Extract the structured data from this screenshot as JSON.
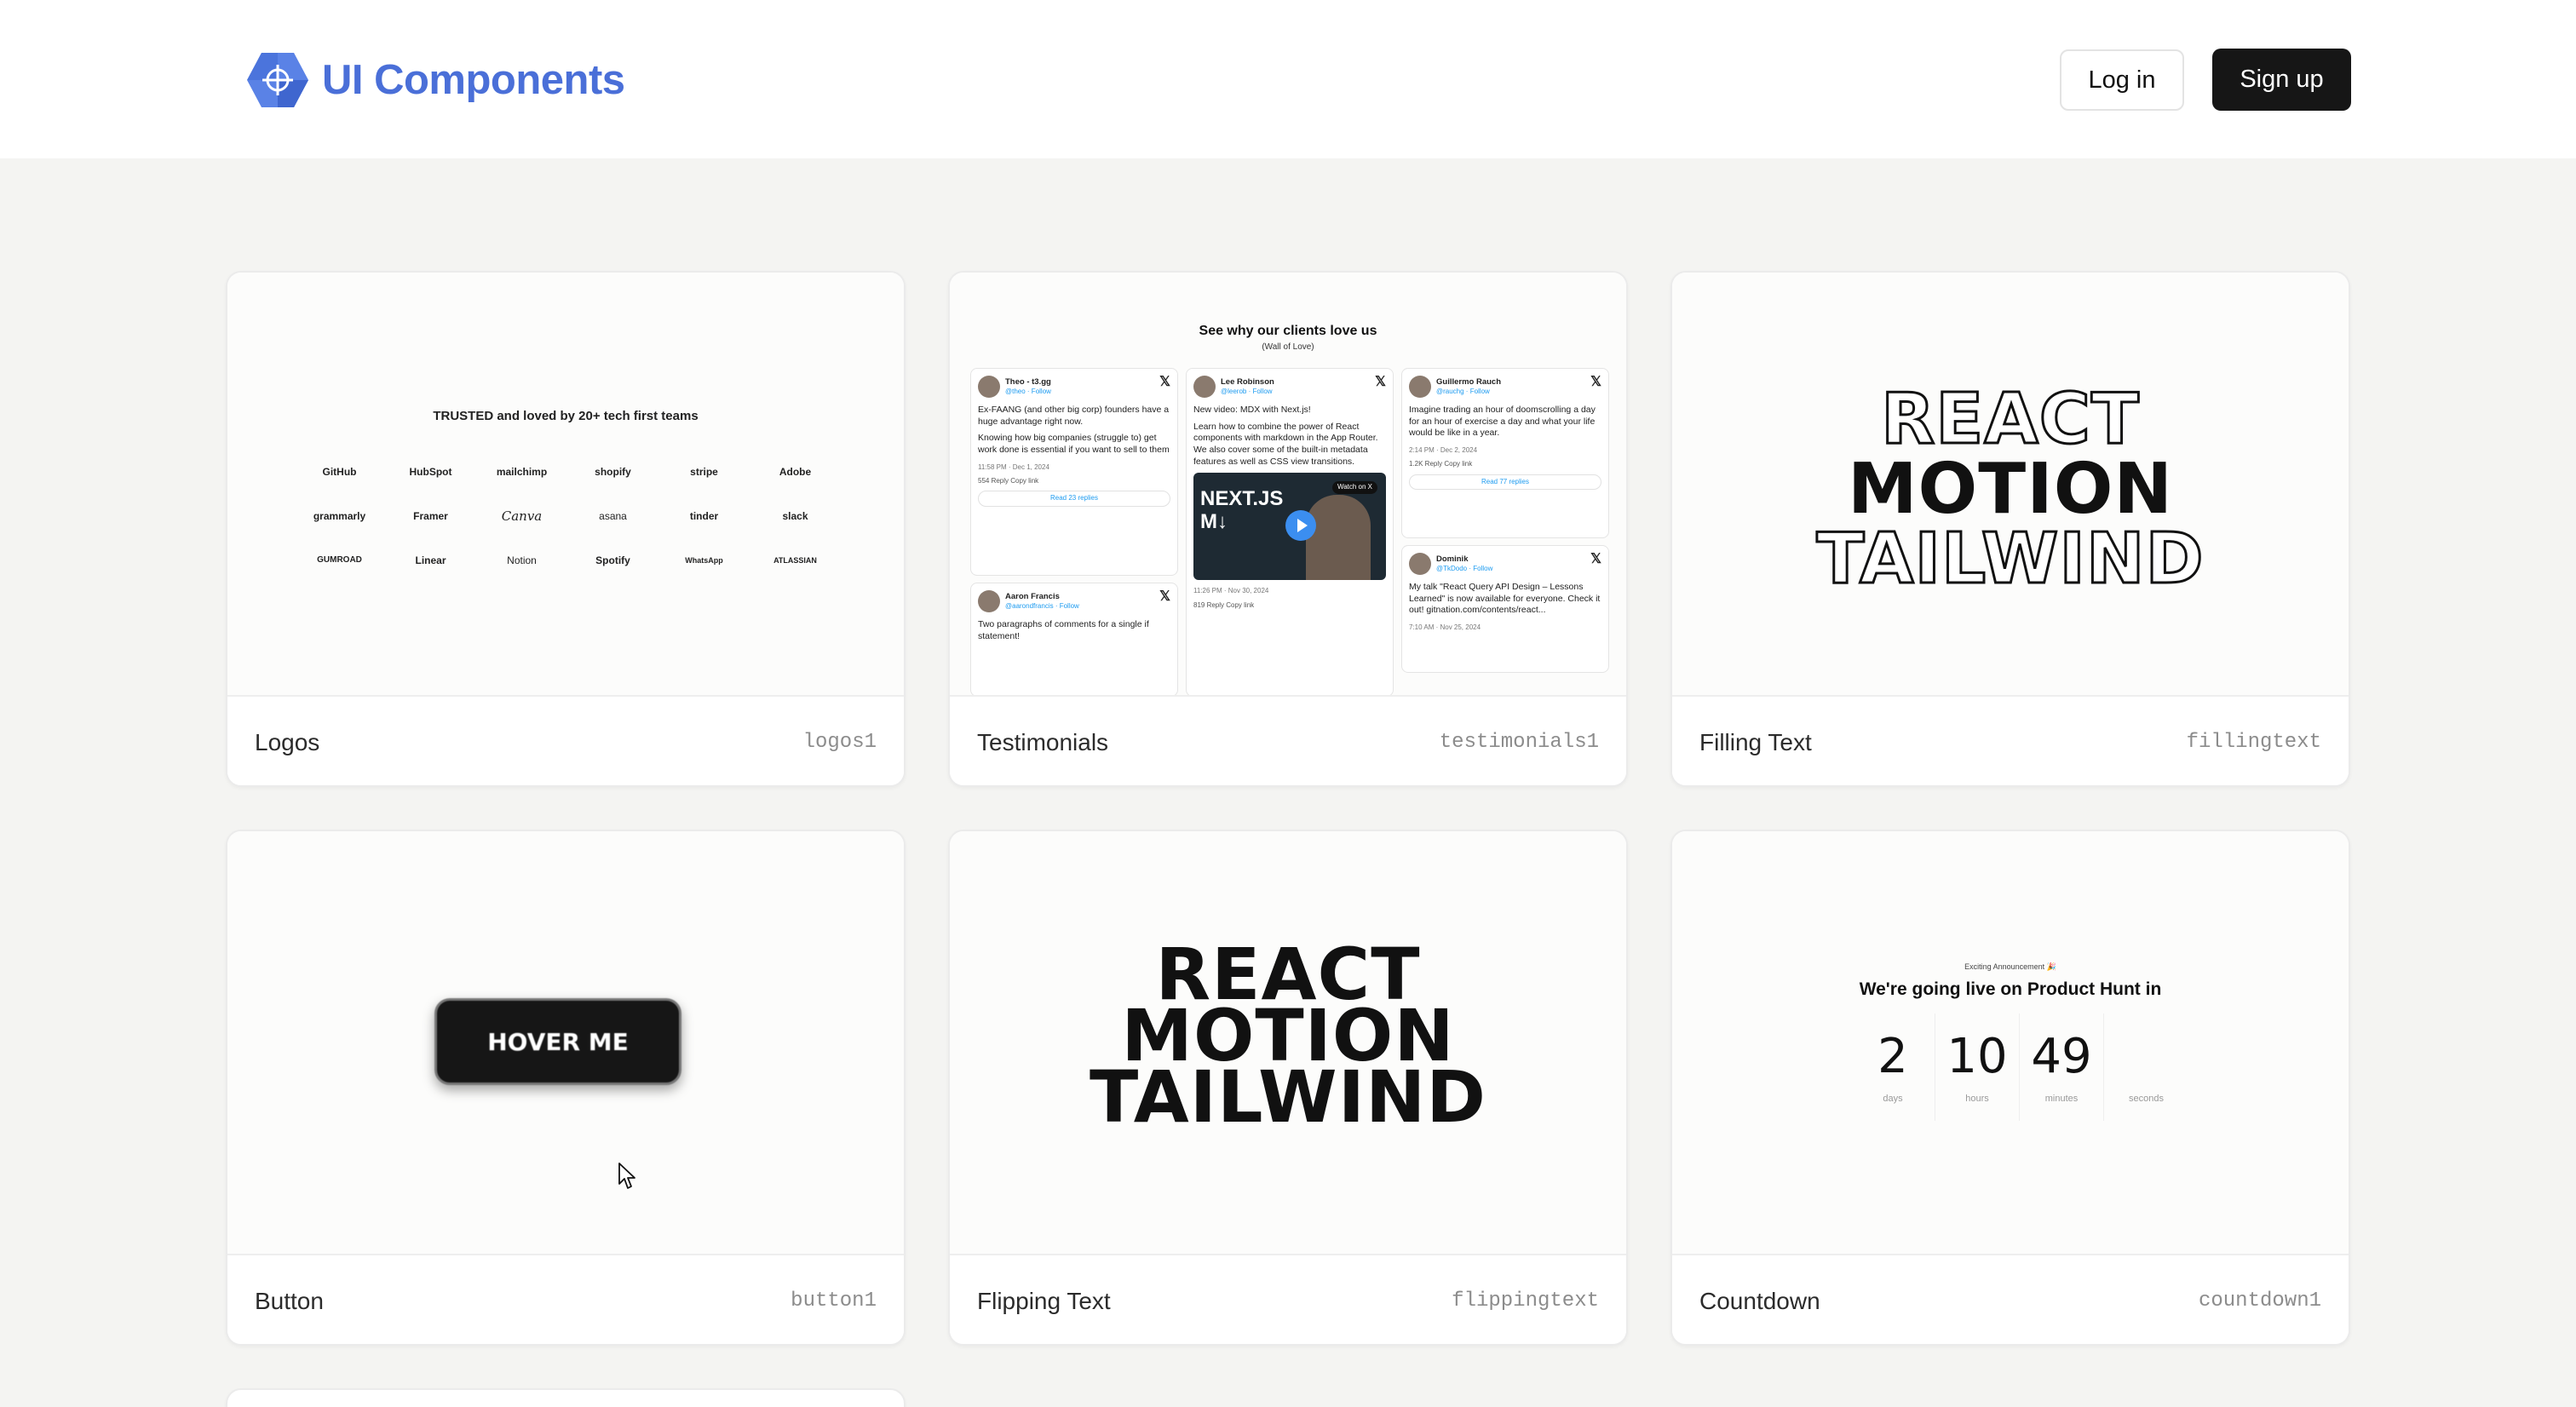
{
  "header": {
    "brand": "UI Components",
    "login_label": "Log in",
    "signup_label": "Sign up",
    "brand_color": "#4a6fd8"
  },
  "cards": [
    {
      "name": "Logos",
      "slug": "logos1",
      "preview": {
        "heading": "TRUSTED and loved by 20+ tech first teams",
        "logos": [
          "GitHub",
          "HubSpot",
          "mailchimp",
          "shopify",
          "stripe",
          "Adobe",
          "grammarly",
          "Framer",
          "Canva",
          "asana",
          "tinder",
          "slack",
          "GUMROAD",
          "Linear",
          "Notion",
          "Spotify",
          "WhatsApp",
          "ATLASSIAN"
        ]
      }
    },
    {
      "name": "Testimonials",
      "slug": "testimonials1",
      "preview": {
        "title": "See why our clients love us",
        "subtitle": "(Wall of Love)",
        "tweets": [
          {
            "name": "Theo - t3.gg",
            "handle": "@theo · Follow",
            "paragraphs": [
              "Ex-FAANG (and other big corp) founders have a huge advantage right now.",
              "Knowing how big companies (struggle to) get work done is essential if you want to sell to them"
            ],
            "meta": "11:58 PM · Dec 1, 2024",
            "actions": "554   Reply   Copy link",
            "more": "Read 23 replies"
          },
          {
            "name": "Lee Robinson",
            "handle": "@leerob · Follow",
            "paragraphs": [
              "New video: MDX with Next.js!",
              "Learn how to combine the power of React components with markdown in the App Router. We also cover some of the built-in metadata features as well as CSS view transitions."
            ],
            "video_label": "NEXT.JS\nM↓",
            "video_badge": "Watch on X",
            "meta": "11:26 PM · Nov 30, 2024",
            "actions": "819   Reply   Copy link"
          },
          {
            "name": "Guillermo Rauch",
            "handle": "@rauchg · Follow",
            "paragraphs": [
              "Imagine trading an hour of doomscrolling a day for an hour of exercise a day and what your life would be like in a year."
            ],
            "meta": "2:14 PM · Dec 2, 2024",
            "actions": "1.2K   Reply   Copy link",
            "more": "Read 77 replies"
          },
          {
            "name": "Aaron Francis",
            "handle": "@aarondfrancis · Follow",
            "paragraphs": [
              "Two paragraphs of comments for a single if statement!"
            ]
          },
          {
            "name": "Dominik",
            "handle": "@TkDodo · Follow",
            "paragraphs": [
              "My talk \"React Query API Design – Lessons Learned\" is now available for everyone. Check it out! gitnation.com/contents/react..."
            ],
            "meta": "7:10 AM · Nov 25, 2024"
          }
        ]
      }
    },
    {
      "name": "Filling Text",
      "slug": "fillingtext",
      "preview": {
        "lines": [
          "REACT",
          "MOTION",
          "TAILWIND"
        ]
      }
    },
    {
      "name": "Button",
      "slug": "button1",
      "preview": {
        "button_label": "HOVER ME"
      }
    },
    {
      "name": "Flipping Text",
      "slug": "flippingtext",
      "preview": {
        "lines": [
          "REACT",
          "MOTION",
          "TAILWIND"
        ]
      }
    },
    {
      "name": "Countdown",
      "slug": "countdown1",
      "preview": {
        "small": "Exciting Announcement 🎉",
        "title": "We're going live on Product Hunt in",
        "units": [
          {
            "value": "2",
            "label": "days"
          },
          {
            "value": "10",
            "label": "hours"
          },
          {
            "value": "49",
            "label": "minutes"
          },
          {
            "value": "",
            "label": "seconds"
          }
        ]
      }
    }
  ]
}
